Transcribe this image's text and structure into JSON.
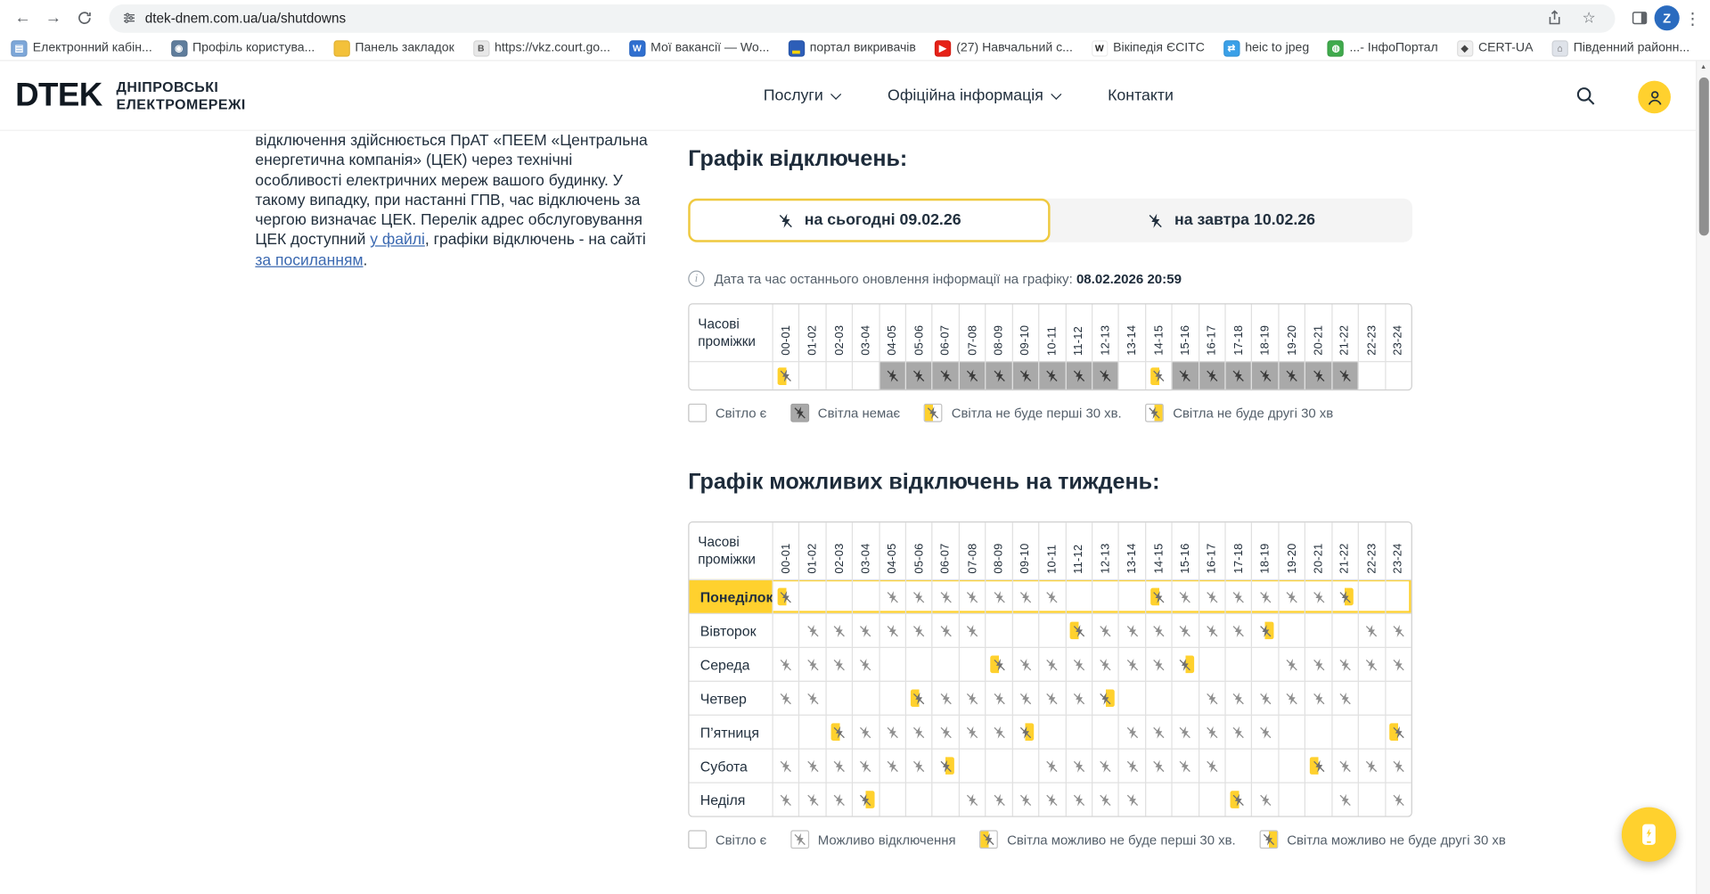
{
  "colors": {
    "accent": "#FFD12E",
    "navy": "#22303E",
    "cell_gray": "#A9A9A9",
    "link": "#3A68B0",
    "tab_border": "#EFC93F"
  },
  "browser": {
    "url": "dtek-dnem.com.ua/ua/shutdowns",
    "avatar_letter": "Z",
    "bookmarks": [
      {
        "label": "Електронний кабін...",
        "icon": "document-icon",
        "color": "#7da7d9",
        "glyph": "▤",
        "fg": "#ffffff"
      },
      {
        "label": "Профіль користува...",
        "icon": "profile-icon",
        "color": "#5f7d9c",
        "glyph": "◉",
        "fg": "#ffffff"
      },
      {
        "label": "Панель закладок",
        "icon": "folder-icon",
        "color": "#f3c13a",
        "glyph": "",
        "fg": "#b78900"
      },
      {
        "label": "https://vkz.court.go...",
        "icon": "vkz-court-icon",
        "color": "#e8e8e8",
        "glyph": "В",
        "fg": "#555555"
      },
      {
        "label": "Мої вакансії — Wo...",
        "icon": "work-icon",
        "color": "#2f6fd0",
        "glyph": "W",
        "fg": "#ffffff"
      },
      {
        "label": "портал викривачів",
        "icon": "ukraine-flag-icon",
        "color": "#2d5eb8",
        "glyph": "▂",
        "fg": "#ffd500"
      },
      {
        "label": "(27) Навчальний с...",
        "icon": "youtube-icon",
        "color": "#e62117",
        "glyph": "▶",
        "fg": "#ffffff"
      },
      {
        "label": "Вікіпедія ЄСІТС",
        "icon": "wikipedia-icon",
        "color": "#ffffff",
        "glyph": "W",
        "fg": "#222222"
      },
      {
        "label": "heic to jpeg",
        "icon": "converter-icon",
        "color": "#3aa0e8",
        "glyph": "⇄",
        "fg": "#ffffff"
      },
      {
        "label": "...- ІнфоПортал",
        "icon": "globe-icon",
        "color": "#3faa4c",
        "glyph": "◍",
        "fg": "#ffffff"
      },
      {
        "label": "CERT-UA",
        "icon": "cert-ua-icon",
        "color": "#f0f0f0",
        "glyph": "◆",
        "fg": "#444444"
      },
      {
        "label": "Південний районн...",
        "icon": "court-icon",
        "color": "#dfe3ea",
        "glyph": "⌂",
        "fg": "#555555"
      }
    ]
  },
  "header": {
    "logo": "DTEK",
    "brand_line1": "ДНІПРОВСЬКІ",
    "brand_line2": "ЕЛЕКТРОМЕРЕЖІ",
    "nav": [
      {
        "label": "Послуги",
        "dropdown": true
      },
      {
        "label": "Офіційна інформація",
        "dropdown": true
      },
      {
        "label": "Контакти",
        "dropdown": false
      }
    ]
  },
  "sidebar": {
    "text1": "відключення здійснюється ПрАТ «ПЕЕМ «Центральна енергетична компанія» (ЦЕК) через технічні особливості електричних мереж вашого будинку. У такому випадку, при настанні ГПВ, час відключень за чергою визначає ЦЕК. Перелік адрес обслуговування ЦЕК доступний ",
    "link1": "у файлі",
    "text2": ", графіки відключень - на сайті ",
    "link2": "за посиланням",
    "text3": "."
  },
  "main": {
    "title_today": "Графік відключень:",
    "tabs": [
      {
        "label": "на сьогодні 09.02.26",
        "active": true
      },
      {
        "label": "на завтра 10.02.26",
        "active": false
      }
    ],
    "update_prefix": "Дата та час останнього оновлення інформації на графіку: ",
    "update_value": "08.02.2026 20:59",
    "time_header": "Часові проміжки",
    "time_slots": [
      "00-01",
      "01-02",
      "02-03",
      "03-04",
      "04-05",
      "05-06",
      "06-07",
      "07-08",
      "08-09",
      "09-10",
      "10-11",
      "11-12",
      "12-13",
      "13-14",
      "14-15",
      "15-16",
      "16-17",
      "17-18",
      "18-19",
      "19-20",
      "20-21",
      "21-22",
      "22-23",
      "23-24"
    ],
    "today_row": [
      "first30",
      "none",
      "none",
      "none",
      "off",
      "off",
      "off",
      "off",
      "off",
      "off",
      "off",
      "off",
      "off",
      "none",
      "first30",
      "off",
      "off",
      "off",
      "off",
      "off",
      "off",
      "off",
      "none",
      "none"
    ],
    "legend_today": [
      {
        "label": "Світло є",
        "type": "none",
        "ctx": "today"
      },
      {
        "label": "Світла немає",
        "type": "off",
        "ctx": "today"
      },
      {
        "label": "Світла не буде перші 30 хв.",
        "type": "first30",
        "ctx": "today"
      },
      {
        "label": "Світла не буде другі 30 хв",
        "type": "second30",
        "ctx": "today"
      }
    ],
    "title_week": "Графік можливих відключень на тиждень:",
    "week_rows": [
      {
        "day": "Понеділок",
        "active": true,
        "cells": [
          "first30",
          "none",
          "none",
          "none",
          "off",
          "off",
          "off",
          "off",
          "off",
          "off",
          "off",
          "none",
          "none",
          "none",
          "first30",
          "off",
          "off",
          "off",
          "off",
          "off",
          "off",
          "second30",
          "none",
          "none"
        ]
      },
      {
        "day": "Вівторок",
        "active": false,
        "cells": [
          "none",
          "off",
          "off",
          "off",
          "off",
          "off",
          "off",
          "off",
          "none",
          "none",
          "none",
          "first30",
          "off",
          "off",
          "off",
          "off",
          "off",
          "off",
          "second30",
          "none",
          "none",
          "none",
          "off",
          "off"
        ]
      },
      {
        "day": "Середа",
        "active": false,
        "cells": [
          "off",
          "off",
          "off",
          "off",
          "none",
          "none",
          "none",
          "none",
          "first30",
          "off",
          "off",
          "off",
          "off",
          "off",
          "off",
          "second30",
          "none",
          "none",
          "none",
          "off",
          "off",
          "off",
          "off",
          "off"
        ]
      },
      {
        "day": "Четвер",
        "active": false,
        "cells": [
          "off",
          "off",
          "none",
          "none",
          "none",
          "first30",
          "off",
          "off",
          "off",
          "off",
          "off",
          "off",
          "second30",
          "none",
          "none",
          "none",
          "off",
          "off",
          "off",
          "off",
          "off",
          "off",
          "none",
          "none"
        ]
      },
      {
        "day": "П’ятниця",
        "active": false,
        "cells": [
          "none",
          "none",
          "first30",
          "off",
          "off",
          "off",
          "off",
          "off",
          "off",
          "second30",
          "none",
          "none",
          "none",
          "off",
          "off",
          "off",
          "off",
          "off",
          "off",
          "none",
          "none",
          "none",
          "none",
          "first30"
        ]
      },
      {
        "day": "Субота",
        "active": false,
        "cells": [
          "off",
          "off",
          "off",
          "off",
          "off",
          "off",
          "second30",
          "none",
          "none",
          "none",
          "off",
          "off",
          "off",
          "off",
          "off",
          "off",
          "off",
          "none",
          "none",
          "none",
          "first30",
          "off",
          "off",
          "off"
        ]
      },
      {
        "day": "Неділя",
        "active": false,
        "cells": [
          "off",
          "off",
          "off",
          "second30",
          "none",
          "none",
          "none",
          "off",
          "off",
          "off",
          "off",
          "off",
          "off",
          "off",
          "none",
          "none",
          "none",
          "first30",
          "off",
          "none",
          "none",
          "off",
          "none",
          "off"
        ]
      }
    ],
    "legend_week": [
      {
        "label": "Світло є",
        "type": "none",
        "ctx": "week"
      },
      {
        "label": "Можливо відключення",
        "type": "off",
        "ctx": "week"
      },
      {
        "label": "Світла можливо не буде перші 30 хв.",
        "type": "first30",
        "ctx": "week"
      },
      {
        "label": "Світла можливо не буде другі 30 хв",
        "type": "second30",
        "ctx": "week"
      }
    ]
  }
}
